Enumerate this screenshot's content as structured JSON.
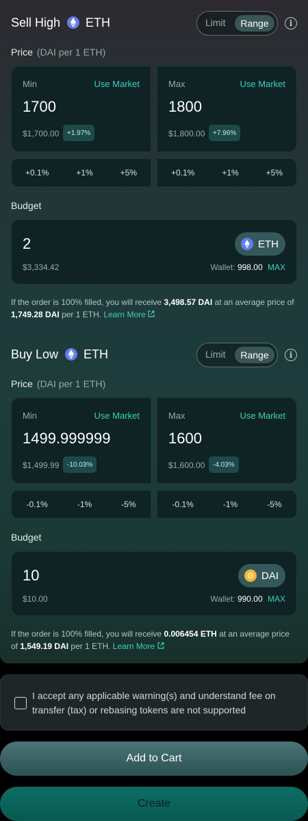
{
  "sell": {
    "title": "Sell High",
    "token": "ETH",
    "toggle": {
      "limit": "Limit",
      "range": "Range"
    },
    "price_label": "Price",
    "price_unit": "(DAI per 1 ETH)",
    "min": {
      "label": "Min",
      "use_market": "Use Market",
      "value": "1700",
      "usd": "$1,700.00",
      "badge": "+1.97%"
    },
    "max": {
      "label": "Max",
      "use_market": "Use Market",
      "value": "1800",
      "usd": "$1,800.00",
      "badge": "+7.96%"
    },
    "min_pcts": [
      "+0.1%",
      "+1%",
      "+5%"
    ],
    "max_pcts": [
      "+0.1%",
      "+1%",
      "+5%"
    ],
    "budget": {
      "label": "Budget",
      "value": "2",
      "usd": "$3,334.42",
      "token": "ETH",
      "wallet_label": "Wallet:",
      "wallet_value": "998.00",
      "max": "MAX"
    },
    "summary": {
      "pre": "If the order is 100% filled, you will receive",
      "amount": "3,498.57 DAI",
      "mid": "at an average price of",
      "price": "1,749.28 DAI",
      "post": "per 1 ETH.",
      "learn": "Learn More"
    }
  },
  "buy": {
    "title": "Buy Low",
    "token": "ETH",
    "toggle": {
      "limit": "Limit",
      "range": "Range"
    },
    "price_label": "Price",
    "price_unit": "(DAI per 1 ETH)",
    "min": {
      "label": "Min",
      "use_market": "Use Market",
      "value": "1499.999999",
      "usd": "$1,499.99",
      "badge": "-10.03%"
    },
    "max": {
      "label": "Max",
      "use_market": "Use Market",
      "value": "1600",
      "usd": "$1,600.00",
      "badge": "-4.03%"
    },
    "min_pcts": [
      "-0.1%",
      "-1%",
      "-5%"
    ],
    "max_pcts": [
      "-0.1%",
      "-1%",
      "-5%"
    ],
    "budget": {
      "label": "Budget",
      "value": "10",
      "usd": "$10.00",
      "token": "DAI",
      "wallet_label": "Wallet:",
      "wallet_value": "990.00",
      "max": "MAX"
    },
    "summary": {
      "pre": "If the order is 100% filled, you will receive",
      "amount": "0.006454 ETH",
      "mid": "at an average price of",
      "price": "1,549.19 DAI",
      "post": "per 1 ETH.",
      "learn": "Learn More"
    }
  },
  "accept": {
    "text": "I accept any applicable warning(s) and understand fee on transfer (tax) or rebasing tokens are not supported"
  },
  "buttons": {
    "add_to_cart": "Add to Cart",
    "create": "Create"
  },
  "colors": {
    "accent": "#39d3bb",
    "eth": "#627eea",
    "dai": "#f4b731"
  }
}
